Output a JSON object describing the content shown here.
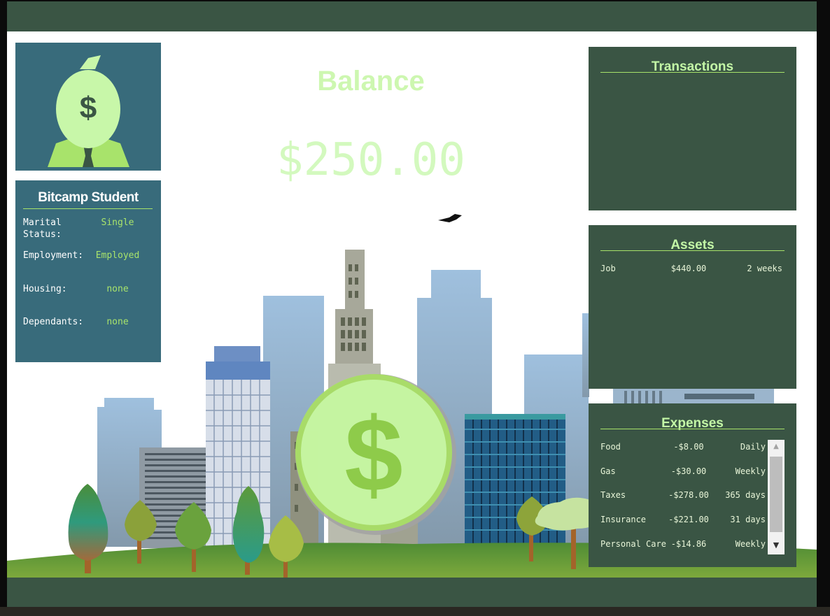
{
  "profile": {
    "title": "Bitcamp Student",
    "rows": [
      {
        "label": "Marital Status:",
        "value": "Single"
      },
      {
        "label": "Employment:",
        "value": "Employed"
      },
      {
        "label": "Housing:",
        "value": "none"
      },
      {
        "label": "Dependants:",
        "value": "none"
      }
    ]
  },
  "balance": {
    "title": "Balance",
    "amount": "$250.00"
  },
  "transactions": {
    "title": "Transactions",
    "items": []
  },
  "assets": {
    "title": "Assets",
    "items": [
      {
        "name": "Job",
        "amount": "$440.00",
        "frequency": "2 weeks"
      }
    ]
  },
  "expenses": {
    "title": "Expenses",
    "items": [
      {
        "name": "Food",
        "amount": "-$8.00",
        "frequency": "Daily"
      },
      {
        "name": "Gas",
        "amount": "-$30.00",
        "frequency": "Weekly"
      },
      {
        "name": "Taxes",
        "amount": "-$278.00",
        "frequency": "365 days"
      },
      {
        "name": "Insurance",
        "amount": "-$221.00",
        "frequency": "31 days"
      },
      {
        "name": "Personal Care",
        "amount": "-$14.86",
        "frequency": "Weekly"
      }
    ]
  },
  "icons": {
    "avatar": "money-bag-head-icon",
    "coin": "dollar-coin-icon",
    "bird": "bird-icon",
    "dollar_sign": "$"
  },
  "colors": {
    "bar_green": "#3a5544",
    "panel_blue": "#386b7b",
    "accent_green": "#a8e36b",
    "balance_text": "#d3f9be"
  }
}
